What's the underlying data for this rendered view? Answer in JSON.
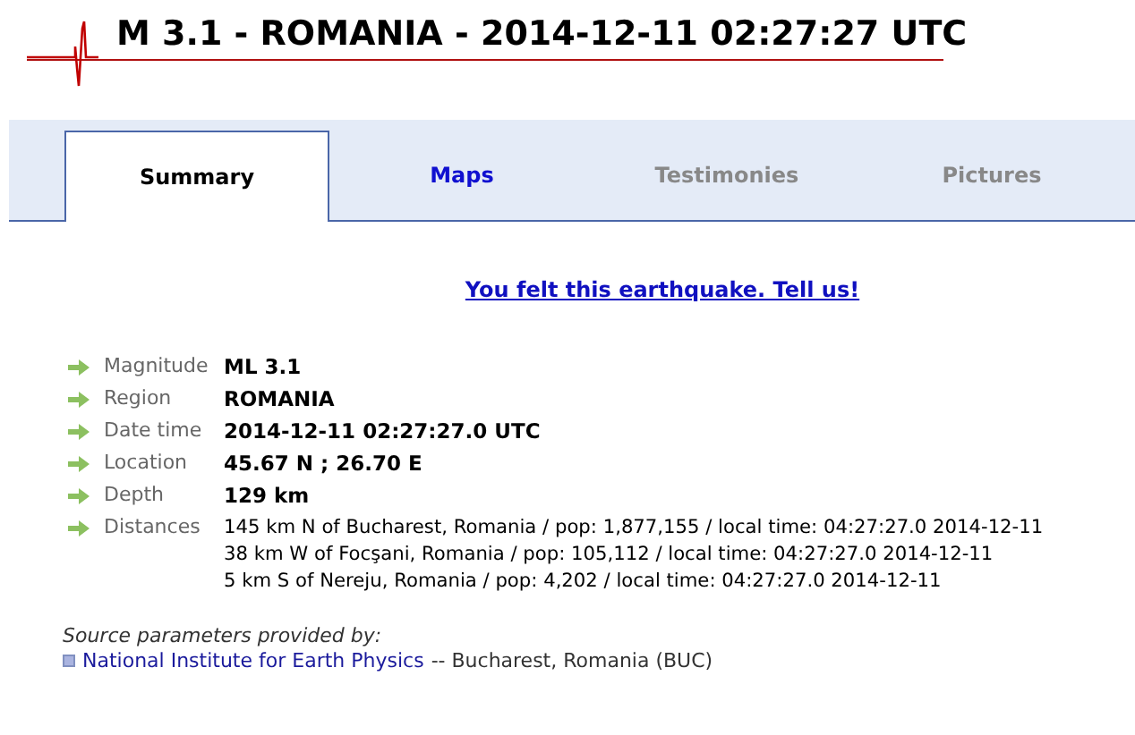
{
  "title": "M 3.1 - ROMANIA - 2014-12-11 02:27:27 UTC",
  "tabs": [
    {
      "label": "Summary",
      "selected": true,
      "disabled": false
    },
    {
      "label": "Maps",
      "selected": false,
      "disabled": false
    },
    {
      "label": "Testimonies",
      "selected": false,
      "disabled": true
    },
    {
      "label": "Pictures",
      "selected": false,
      "disabled": true
    }
  ],
  "felt_link": "You felt this earthquake. Tell us!",
  "details": [
    {
      "label": "Magnitude",
      "values": [
        "ML 3.1"
      ],
      "bold": true
    },
    {
      "label": "Region",
      "values": [
        "ROMANIA"
      ],
      "bold": true
    },
    {
      "label": "Date time",
      "values": [
        "2014-12-11 02:27:27.0 UTC"
      ],
      "bold": true
    },
    {
      "label": "Location",
      "values": [
        "45.67 N ; 26.70 E"
      ],
      "bold": true
    },
    {
      "label": "Depth",
      "values": [
        "129 km"
      ],
      "bold": true
    },
    {
      "label": "Distances",
      "values": [
        "145 km N of Bucharest, Romania / pop: 1,877,155 / local time: 04:27:27.0 2014-12-11",
        "38 km W of Focşani, Romania / pop: 105,112 / local time: 04:27:27.0 2014-12-11",
        "5 km S of Nereju, Romania / pop: 4,202 / local time: 04:27:27.0 2014-12-11"
      ],
      "bold": false
    }
  ],
  "source": {
    "caption": "Source parameters provided by:",
    "link": "National Institute for Earth Physics",
    "suffix": "-- Bucharest, Romania (BUC)"
  }
}
